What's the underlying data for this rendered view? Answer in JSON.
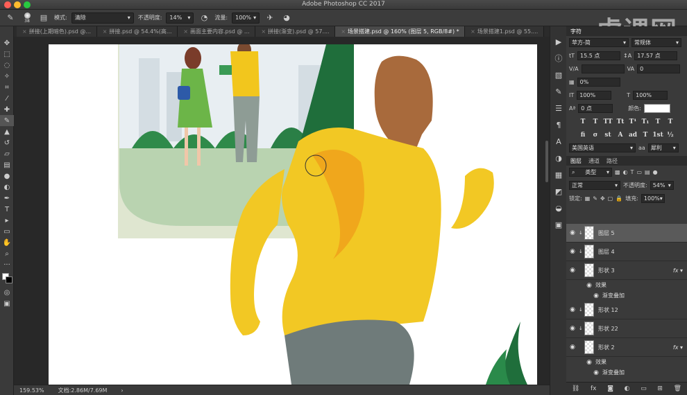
{
  "window": {
    "title": "Adobe Photoshop CC 2017"
  },
  "options_bar": {
    "brush_size": "38",
    "mode_label": "模式:",
    "mode_value": "清除",
    "opacity_label": "不透明度:",
    "opacity_value": "14%",
    "flow_label": "流量:",
    "flow_value": "100%"
  },
  "watermark": "虎课网",
  "tabs": [
    {
      "label": "拼接(上期暗色).psd @..."
    },
    {
      "label": "拼接.psd @ 54.4%(高..."
    },
    {
      "label": "画面主要内容.psd @ ..."
    },
    {
      "label": "拼接(渐变).psd @ 57...."
    },
    {
      "label": "场景搭建.psd @ 160% (图层 5, RGB/8#) *"
    },
    {
      "label": "场景搭建1.psd @ 55...."
    }
  ],
  "status": {
    "zoom": "159.53%",
    "doc": "文档:2.86M/7.69M"
  },
  "character_panel": {
    "tab": "字符",
    "font_family": "苹方-简",
    "font_style": "常规体",
    "font_size": "15.5 点",
    "leading": "17.57 点",
    "kerning": "",
    "tracking": "0",
    "tsume": "0%",
    "vscale": "100%",
    "hscale": "100%",
    "baseline": "0 点",
    "color_label": "颜色:",
    "language": "美国英语",
    "antialias": "犀利"
  },
  "layers_panel": {
    "tabs": [
      "图层",
      "通道",
      "路径"
    ],
    "filter": "类型",
    "blend_mode": "正常",
    "opacity_label": "不透明度:",
    "opacity_value": "54%",
    "lock_label": "锁定:",
    "fill_label": "填充:",
    "fill_value": "100%",
    "layers": [
      {
        "name": "图层 5",
        "selected": true
      },
      {
        "name": "图层 4"
      },
      {
        "name": "形状 3",
        "fx": true
      },
      {
        "name": "效果",
        "sub": true
      },
      {
        "name": "渐变叠加",
        "sub": true
      },
      {
        "name": "形状 12"
      },
      {
        "name": "形状 22"
      },
      {
        "name": "形状 2",
        "fx": true
      },
      {
        "name": "效果",
        "sub": true
      },
      {
        "name": "渐变叠加",
        "sub": true
      }
    ]
  }
}
